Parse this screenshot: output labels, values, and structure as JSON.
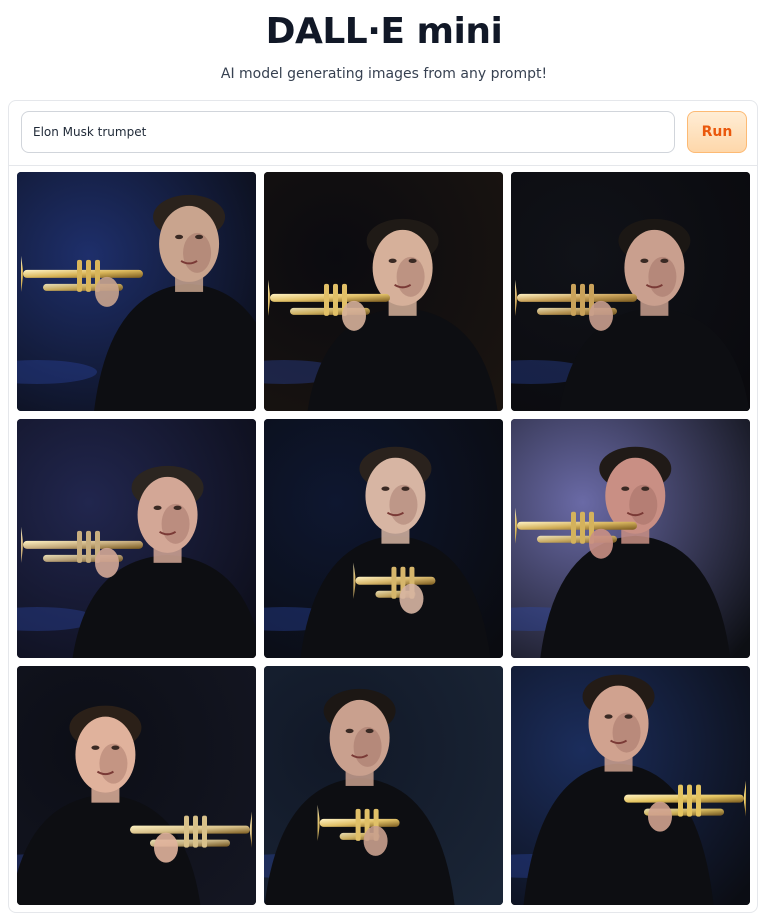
{
  "header": {
    "title": "DALL·E mini",
    "subtitle": "AI model generating images from any prompt!"
  },
  "prompt": {
    "value": "Elon Musk trumpet"
  },
  "run_button": {
    "label": "Run"
  },
  "gallery": {
    "images": [
      {
        "name": "generated-image-1",
        "bg": "#1e2f6b",
        "accent": "#0a0c14",
        "skin": "#c9a48e",
        "hair": "#2a221c",
        "brass": "#d9b65a",
        "face_x": 0.72,
        "face_y": 0.28,
        "horn": "left"
      },
      {
        "name": "generated-image-2",
        "bg": "#0b0b10",
        "accent": "#1a1410",
        "skin": "#d6b09a",
        "hair": "#1f1a16",
        "brass": "#e1c067",
        "face_x": 0.58,
        "face_y": 0.38,
        "horn": "left"
      },
      {
        "name": "generated-image-3",
        "bg": "#101218",
        "accent": "#0a0a0e",
        "skin": "#c99f8e",
        "hair": "#1b1714",
        "brass": "#c9a25a",
        "face_x": 0.6,
        "face_y": 0.38,
        "horn": "left"
      },
      {
        "name": "generated-image-4",
        "bg": "#21264e",
        "accent": "#0c0d18",
        "skin": "#d3a796",
        "hair": "#2b2520",
        "brass": "#c8ae7f",
        "face_x": 0.63,
        "face_y": 0.38,
        "horn": "left"
      },
      {
        "name": "generated-image-5",
        "bg": "#0e1730",
        "accent": "#0a0b10",
        "skin": "#d7b5a3",
        "hair": "#2a221d",
        "brass": "#d6b66b",
        "face_x": 0.55,
        "face_y": 0.3,
        "horn": "center"
      },
      {
        "name": "generated-image-6",
        "bg": "#6a6aa6",
        "accent": "#0d0f14",
        "skin": "#c98f84",
        "hair": "#201a17",
        "brass": "#d4b25c",
        "face_x": 0.52,
        "face_y": 0.3,
        "horn": "left"
      },
      {
        "name": "generated-image-7",
        "bg": "#0c0e16",
        "accent": "#141622",
        "skin": "#e0b29c",
        "hair": "#2b2018",
        "brass": "#d8c18a",
        "face_x": 0.37,
        "face_y": 0.35,
        "horn": "right"
      },
      {
        "name": "generated-image-8",
        "bg": "#111827",
        "accent": "#1a2536",
        "skin": "#c9a08e",
        "hair": "#1c1714",
        "brass": "#e0c068",
        "face_x": 0.4,
        "face_y": 0.28,
        "horn": "center"
      },
      {
        "name": "generated-image-9",
        "bg": "#1b2d5c",
        "accent": "#0b0d14",
        "skin": "#d0a28f",
        "hair": "#231b16",
        "brass": "#e4c460",
        "face_x": 0.45,
        "face_y": 0.22,
        "horn": "right"
      }
    ]
  }
}
